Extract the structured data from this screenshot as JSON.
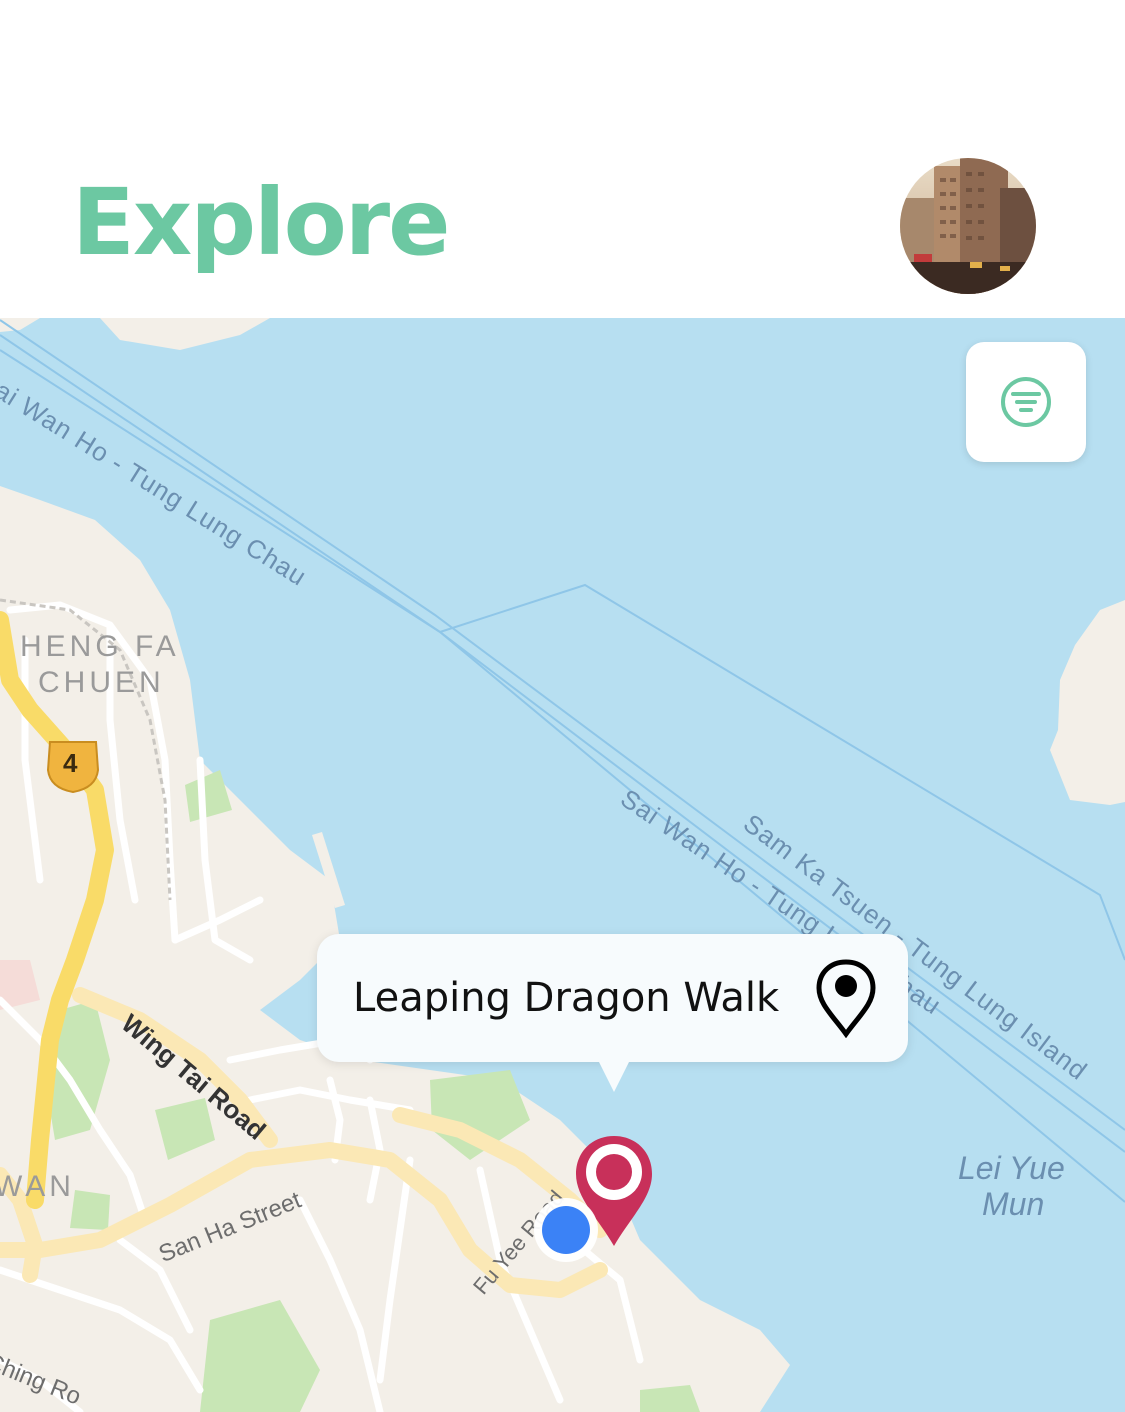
{
  "header": {
    "title": "Explore",
    "avatar_alt": "Profile photo"
  },
  "map": {
    "labels": {
      "ferry_route_1": "Sai Wan Ho - Tung Lung Chau",
      "ferry_route_2": "Sai Wan Ho - Tung Lung Chau",
      "ferry_route_3": "Sam Ka Tsuen - Tung Lung Island",
      "heng_fa_chuen_line1": "HENG FA",
      "heng_fa_chuen_line2": "CHUEN",
      "route_shield": "4",
      "wing_tai_road": "Wing Tai Road",
      "san_ha_street": "San Ha Street",
      "fu_yee_road": "Fu Yee Road",
      "lei_yue_mun_line1": "Lei Yue",
      "lei_yue_mun_line2": "Mun",
      "wan_fragment": "WAN",
      "ching_fragment": "Ching Ro"
    },
    "filter_icon": "filter-lines-icon",
    "callout": {
      "label": "Leaping Dragon Walk",
      "icon": "location-pin-icon"
    },
    "selected_pin": {
      "icon": "map-pin-icon",
      "color": "#C8305A"
    },
    "user_location": {
      "color": "#3B82F6"
    }
  },
  "colors": {
    "accent": "#6CC8A2",
    "water": "#B7DFF1",
    "land": "#F3EFE8",
    "park": "#C8E6B5",
    "major_road": "#F9DB68"
  }
}
